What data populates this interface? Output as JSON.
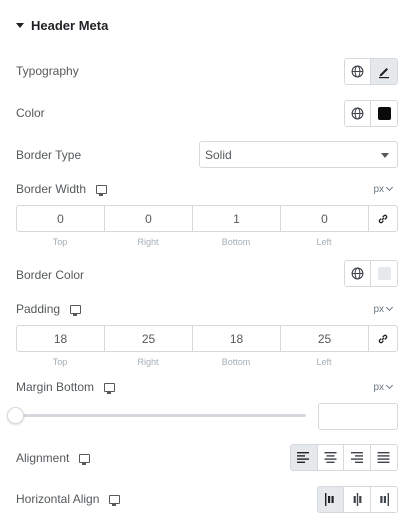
{
  "section": {
    "title": "Header Meta"
  },
  "typography": {
    "label": "Typography",
    "global_icon": "globe-icon",
    "edit_icon": "pencil-icon"
  },
  "color": {
    "label": "Color",
    "global_icon": "globe-icon",
    "swatch": "#0b0b0b"
  },
  "border_type": {
    "label": "Border Type",
    "value": "Solid"
  },
  "border_width": {
    "label": "Border Width",
    "unit": "px",
    "values": [
      "0",
      "0",
      "1",
      "0"
    ],
    "sides": [
      "Top",
      "Right",
      "Bottom",
      "Left"
    ]
  },
  "border_color": {
    "label": "Border Color",
    "swatch": "#e6e9ec"
  },
  "padding": {
    "label": "Padding",
    "unit": "px",
    "values": [
      "18",
      "25",
      "18",
      "25"
    ],
    "sides": [
      "Top",
      "Right",
      "Bottom",
      "Left"
    ]
  },
  "margin_bottom": {
    "label": "Margin Bottom",
    "unit": "px",
    "value": "",
    "slider_fraction": 0
  },
  "alignment": {
    "label": "Alignment",
    "options": [
      "align-left-icon",
      "align-center-icon",
      "align-right-icon",
      "align-justify-icon"
    ],
    "selected": "align-left-icon"
  },
  "horizontal_align": {
    "label": "Horizontal Align",
    "options": [
      "justify-start-icon",
      "justify-center-icon",
      "justify-end-icon"
    ],
    "selected": "justify-start-icon"
  },
  "colors": {
    "border": "#d5d8dc",
    "active_bg": "#e6e9ec",
    "text": "#55595c",
    "heading": "#1f2124"
  }
}
